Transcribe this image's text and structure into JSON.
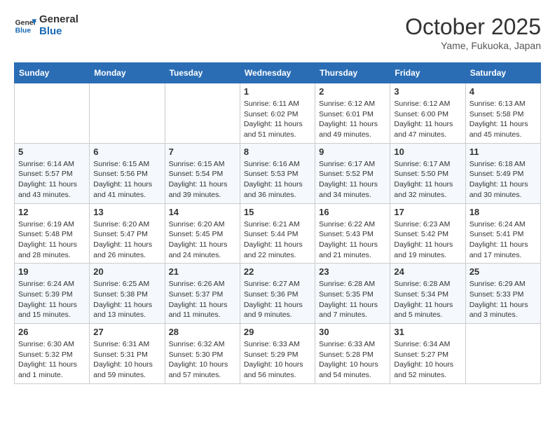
{
  "header": {
    "logo_general": "General",
    "logo_blue": "Blue",
    "month": "October 2025",
    "location": "Yame, Fukuoka, Japan"
  },
  "weekdays": [
    "Sunday",
    "Monday",
    "Tuesday",
    "Wednesday",
    "Thursday",
    "Friday",
    "Saturday"
  ],
  "weeks": [
    [
      {
        "day": "",
        "sunrise": "",
        "sunset": "",
        "daylight": ""
      },
      {
        "day": "",
        "sunrise": "",
        "sunset": "",
        "daylight": ""
      },
      {
        "day": "",
        "sunrise": "",
        "sunset": "",
        "daylight": ""
      },
      {
        "day": "1",
        "sunrise": "Sunrise: 6:11 AM",
        "sunset": "Sunset: 6:02 PM",
        "daylight": "Daylight: 11 hours and 51 minutes."
      },
      {
        "day": "2",
        "sunrise": "Sunrise: 6:12 AM",
        "sunset": "Sunset: 6:01 PM",
        "daylight": "Daylight: 11 hours and 49 minutes."
      },
      {
        "day": "3",
        "sunrise": "Sunrise: 6:12 AM",
        "sunset": "Sunset: 6:00 PM",
        "daylight": "Daylight: 11 hours and 47 minutes."
      },
      {
        "day": "4",
        "sunrise": "Sunrise: 6:13 AM",
        "sunset": "Sunset: 5:58 PM",
        "daylight": "Daylight: 11 hours and 45 minutes."
      }
    ],
    [
      {
        "day": "5",
        "sunrise": "Sunrise: 6:14 AM",
        "sunset": "Sunset: 5:57 PM",
        "daylight": "Daylight: 11 hours and 43 minutes."
      },
      {
        "day": "6",
        "sunrise": "Sunrise: 6:15 AM",
        "sunset": "Sunset: 5:56 PM",
        "daylight": "Daylight: 11 hours and 41 minutes."
      },
      {
        "day": "7",
        "sunrise": "Sunrise: 6:15 AM",
        "sunset": "Sunset: 5:54 PM",
        "daylight": "Daylight: 11 hours and 39 minutes."
      },
      {
        "day": "8",
        "sunrise": "Sunrise: 6:16 AM",
        "sunset": "Sunset: 5:53 PM",
        "daylight": "Daylight: 11 hours and 36 minutes."
      },
      {
        "day": "9",
        "sunrise": "Sunrise: 6:17 AM",
        "sunset": "Sunset: 5:52 PM",
        "daylight": "Daylight: 11 hours and 34 minutes."
      },
      {
        "day": "10",
        "sunrise": "Sunrise: 6:17 AM",
        "sunset": "Sunset: 5:50 PM",
        "daylight": "Daylight: 11 hours and 32 minutes."
      },
      {
        "day": "11",
        "sunrise": "Sunrise: 6:18 AM",
        "sunset": "Sunset: 5:49 PM",
        "daylight": "Daylight: 11 hours and 30 minutes."
      }
    ],
    [
      {
        "day": "12",
        "sunrise": "Sunrise: 6:19 AM",
        "sunset": "Sunset: 5:48 PM",
        "daylight": "Daylight: 11 hours and 28 minutes."
      },
      {
        "day": "13",
        "sunrise": "Sunrise: 6:20 AM",
        "sunset": "Sunset: 5:47 PM",
        "daylight": "Daylight: 11 hours and 26 minutes."
      },
      {
        "day": "14",
        "sunrise": "Sunrise: 6:20 AM",
        "sunset": "Sunset: 5:45 PM",
        "daylight": "Daylight: 11 hours and 24 minutes."
      },
      {
        "day": "15",
        "sunrise": "Sunrise: 6:21 AM",
        "sunset": "Sunset: 5:44 PM",
        "daylight": "Daylight: 11 hours and 22 minutes."
      },
      {
        "day": "16",
        "sunrise": "Sunrise: 6:22 AM",
        "sunset": "Sunset: 5:43 PM",
        "daylight": "Daylight: 11 hours and 21 minutes."
      },
      {
        "day": "17",
        "sunrise": "Sunrise: 6:23 AM",
        "sunset": "Sunset: 5:42 PM",
        "daylight": "Daylight: 11 hours and 19 minutes."
      },
      {
        "day": "18",
        "sunrise": "Sunrise: 6:24 AM",
        "sunset": "Sunset: 5:41 PM",
        "daylight": "Daylight: 11 hours and 17 minutes."
      }
    ],
    [
      {
        "day": "19",
        "sunrise": "Sunrise: 6:24 AM",
        "sunset": "Sunset: 5:39 PM",
        "daylight": "Daylight: 11 hours and 15 minutes."
      },
      {
        "day": "20",
        "sunrise": "Sunrise: 6:25 AM",
        "sunset": "Sunset: 5:38 PM",
        "daylight": "Daylight: 11 hours and 13 minutes."
      },
      {
        "day": "21",
        "sunrise": "Sunrise: 6:26 AM",
        "sunset": "Sunset: 5:37 PM",
        "daylight": "Daylight: 11 hours and 11 minutes."
      },
      {
        "day": "22",
        "sunrise": "Sunrise: 6:27 AM",
        "sunset": "Sunset: 5:36 PM",
        "daylight": "Daylight: 11 hours and 9 minutes."
      },
      {
        "day": "23",
        "sunrise": "Sunrise: 6:28 AM",
        "sunset": "Sunset: 5:35 PM",
        "daylight": "Daylight: 11 hours and 7 minutes."
      },
      {
        "day": "24",
        "sunrise": "Sunrise: 6:28 AM",
        "sunset": "Sunset: 5:34 PM",
        "daylight": "Daylight: 11 hours and 5 minutes."
      },
      {
        "day": "25",
        "sunrise": "Sunrise: 6:29 AM",
        "sunset": "Sunset: 5:33 PM",
        "daylight": "Daylight: 11 hours and 3 minutes."
      }
    ],
    [
      {
        "day": "26",
        "sunrise": "Sunrise: 6:30 AM",
        "sunset": "Sunset: 5:32 PM",
        "daylight": "Daylight: 11 hours and 1 minute."
      },
      {
        "day": "27",
        "sunrise": "Sunrise: 6:31 AM",
        "sunset": "Sunset: 5:31 PM",
        "daylight": "Daylight: 10 hours and 59 minutes."
      },
      {
        "day": "28",
        "sunrise": "Sunrise: 6:32 AM",
        "sunset": "Sunset: 5:30 PM",
        "daylight": "Daylight: 10 hours and 57 minutes."
      },
      {
        "day": "29",
        "sunrise": "Sunrise: 6:33 AM",
        "sunset": "Sunset: 5:29 PM",
        "daylight": "Daylight: 10 hours and 56 minutes."
      },
      {
        "day": "30",
        "sunrise": "Sunrise: 6:33 AM",
        "sunset": "Sunset: 5:28 PM",
        "daylight": "Daylight: 10 hours and 54 minutes."
      },
      {
        "day": "31",
        "sunrise": "Sunrise: 6:34 AM",
        "sunset": "Sunset: 5:27 PM",
        "daylight": "Daylight: 10 hours and 52 minutes."
      },
      {
        "day": "",
        "sunrise": "",
        "sunset": "",
        "daylight": ""
      }
    ]
  ]
}
